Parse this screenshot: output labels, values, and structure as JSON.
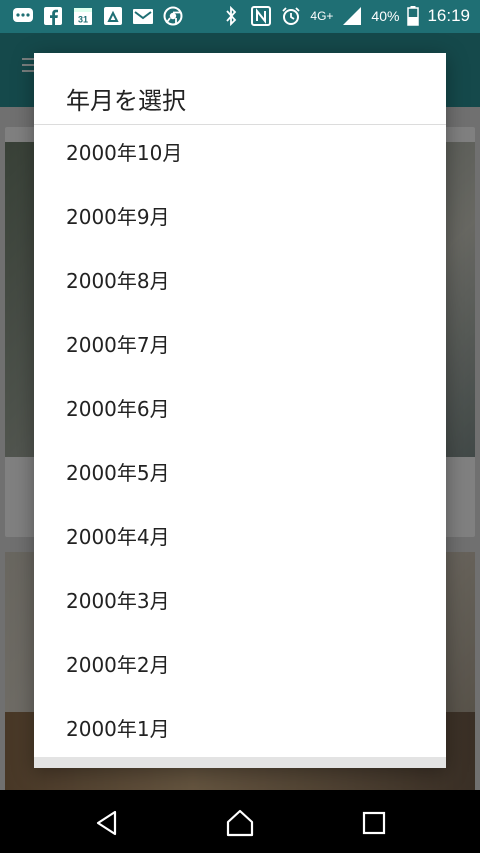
{
  "status_bar": {
    "network": "4G+",
    "battery_percent": "40%",
    "time": "16:19",
    "calendar_date": "31",
    "icons": [
      "messages-icon",
      "facebook-icon",
      "calendar-icon",
      "drive-icon",
      "gmail-icon",
      "chrome-icon",
      "bluetooth-icon",
      "nfc-icon",
      "alarm-icon",
      "signal-icon",
      "battery-icon"
    ]
  },
  "dialog": {
    "title": "年月を選択",
    "months": [
      "2000年10月",
      "2000年9月",
      "2000年8月",
      "2000年7月",
      "2000年6月",
      "2000年5月",
      "2000年4月",
      "2000年3月",
      "2000年2月",
      "2000年1月"
    ]
  },
  "nav_bar": {
    "icons": [
      "back-icon",
      "home-icon",
      "recents-icon"
    ]
  }
}
